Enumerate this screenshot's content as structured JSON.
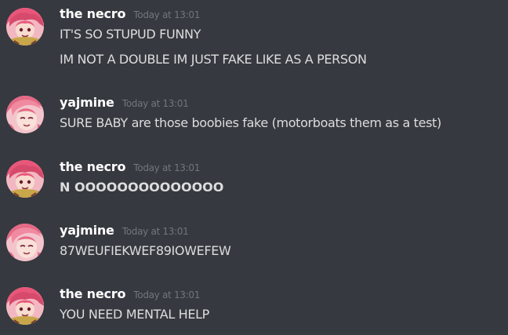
{
  "messages": [
    {
      "username": "the necro",
      "timestamp": "Today at 13:01",
      "avatar_icon": "necro-avatar",
      "lines": [
        "IT'S SO STUPUD FUNNY",
        "IM NOT A DOUBLE IM JUST FAKE LIKE AS A PERSON"
      ]
    },
    {
      "username": "yajmine",
      "timestamp": "Today at 13:01",
      "avatar_icon": "yajmine-avatar",
      "lines": [
        "SURE BABY are those boobies fake (motorboats them as a test)"
      ]
    },
    {
      "username": "the necro",
      "timestamp": "Today at 13:01",
      "avatar_icon": "necro-avatar",
      "lines": [
        "N OOOOOOOOOOOOOO"
      ]
    },
    {
      "username": "yajmine",
      "timestamp": "Today at 13:01",
      "avatar_icon": "yajmine-avatar",
      "lines": [
        "87WEUFIEKWEF89IOWEFEW"
      ]
    },
    {
      "username": "the necro",
      "timestamp": "Today at 13:01",
      "avatar_icon": "necro-avatar",
      "lines": [
        "YOU NEED MENTAL HELP"
      ]
    }
  ],
  "colors": {
    "background": "#36393f",
    "username": "#ffffff",
    "timestamp": "#72767d",
    "message_text": "#dcddde"
  }
}
